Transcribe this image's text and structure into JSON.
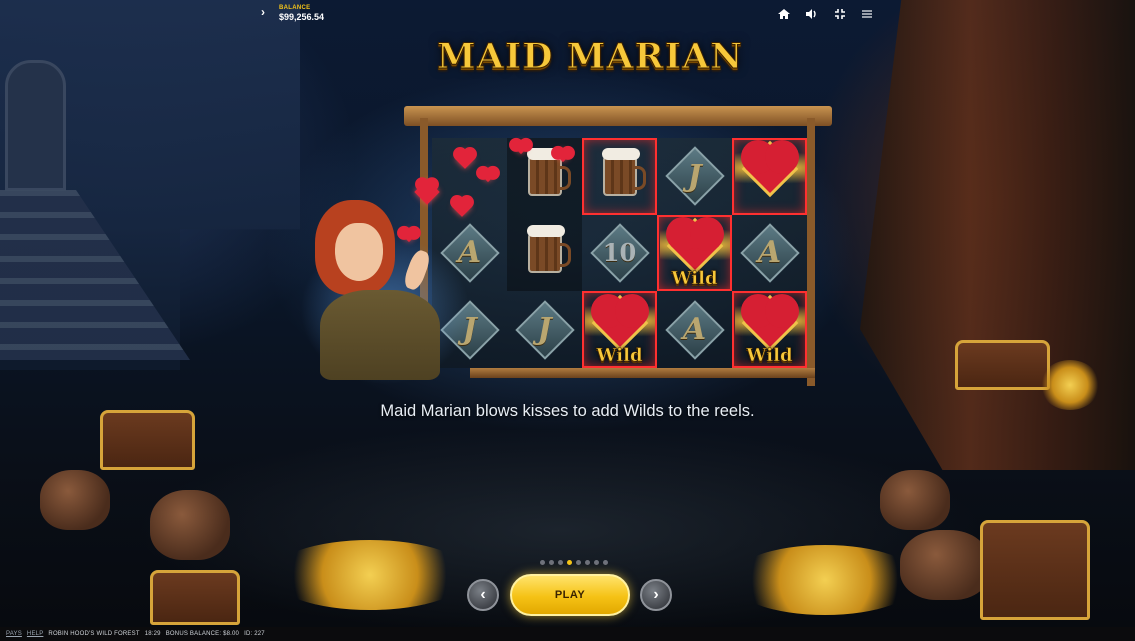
{
  "topbar": {
    "balance_label": "BALANCE",
    "balance_value": "$99,256.54",
    "icons": [
      "home-icon",
      "sound-icon",
      "fullscreen-icon",
      "menu-icon"
    ]
  },
  "info_screen": {
    "title": "MAID MARIAN",
    "caption": "Maid Marian blows kisses to add Wilds to the reels.",
    "reels": [
      [
        "heart",
        "mug",
        "mug",
        "J",
        "wild-heart"
      ],
      [
        "A",
        "mug",
        "10",
        "wild",
        "A"
      ],
      [
        "J",
        "J",
        "wild",
        "A",
        "wild"
      ]
    ],
    "wild_label": "Wild",
    "symbol_letters": {
      "a": "A",
      "j": "J",
      "ten": "10"
    }
  },
  "pagination": {
    "total": 8,
    "active_index": 3
  },
  "controls": {
    "play_label": "PLAY",
    "prev_icon": "‹",
    "next_icon": "›"
  },
  "statusbar": {
    "pays": "PAYS",
    "help": "HELP",
    "game_name": "ROBIN HOOD'S WILD FOREST",
    "time": "18:29",
    "bonus_balance": "BONUS BALANCE: $8.00",
    "id": "ID: 227"
  },
  "colors": {
    "accent_gold": "#f5c518",
    "highlight_red": "#ff3030",
    "wild_heart": "#d61f33"
  }
}
